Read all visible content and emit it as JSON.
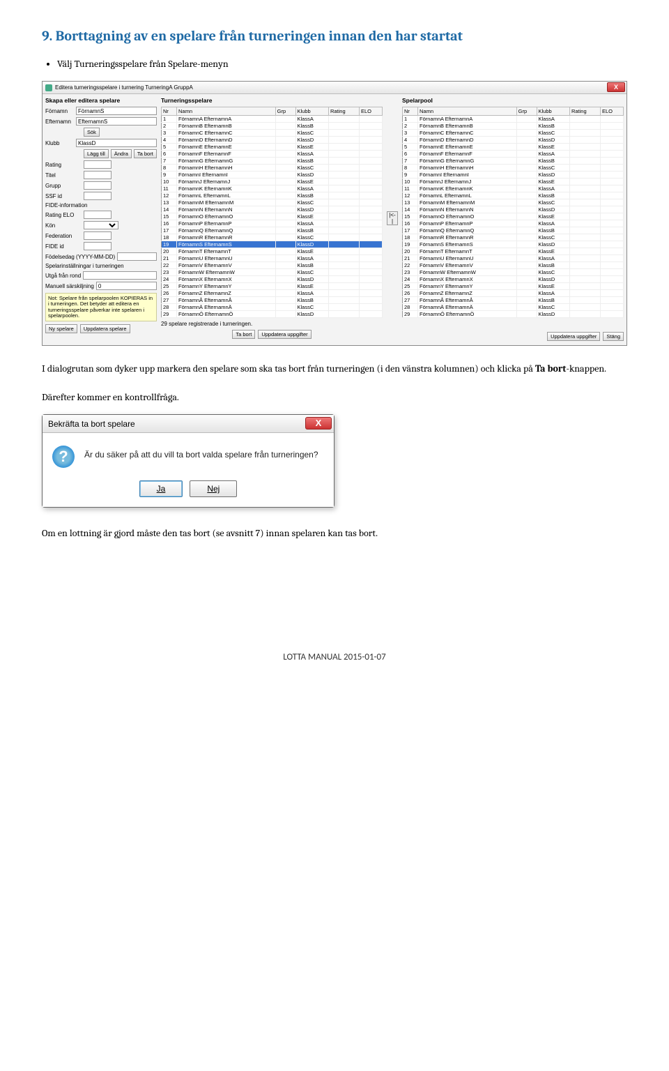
{
  "section": {
    "title": "9. Borttagning av en spelare från turneringen innan den har startat",
    "bullet": "Välj Turneringsspelare från Spelare-menyn"
  },
  "win": {
    "title": "Editera turneringsspelare i turnering TurneringA GruppA",
    "close": "X",
    "left": {
      "heading": "Skapa eller editera spelare",
      "fornamn_label": "Förnamn",
      "fornamn_value": "FörnamnS",
      "efternamn_label": "Efternamn",
      "efternamn_value": "EfternamnS",
      "sok": "Sök",
      "klubb_label": "Klubb",
      "klubb_value": "KlassD",
      "laggtill": "Lägg till",
      "andra": "Ändra",
      "tabort": "Ta bort",
      "rating_label": "Rating",
      "titel_label": "Titel",
      "grupp_label": "Grupp",
      "ssfid_label": "SSF id",
      "fide_label": "FIDE-information",
      "ratingelo_label": "Rating ELO",
      "kon_label": "Kön",
      "federation_label": "Federation",
      "fideid_label": "FIDE id",
      "fodelsedag_label": "Födelsedag (YYYY-MM-DD)",
      "spelarinst_label": "Spelarinställningar i turneringen",
      "utga_label": "Utgå från rond",
      "manuell_label": "Manuell särskiljning",
      "manuell_value": "0",
      "note": "Not: Spelare från spelarpoolen KOPIERAS in i turneringen.\nDet betyder att editera en turneringsspelare påverkar inte spelaren i spelarpoolen.",
      "nyspelare": "Ny spelare",
      "uppdatera": "Uppdatera spelare"
    },
    "mid": {
      "heading": "Turneringsspelare",
      "cols": {
        "nr": "Nr",
        "namn": "Namn",
        "grp": "Grp",
        "klubb": "Klubb",
        "rating": "Rating",
        "elo": "ELO"
      },
      "status": "29 spelare registrerade i turneringen.",
      "tabort": "Ta bort",
      "uppdatera": "Uppdatera uppgifter"
    },
    "right": {
      "heading": "Spelarpool",
      "cols": {
        "nr": "Nr",
        "namn": "Namn",
        "grp": "Grp",
        "klubb": "Klubb",
        "rating": "Rating",
        "elo": "ELO"
      },
      "uppdatera": "Uppdatera uppgifter",
      "stang": "Stäng"
    },
    "arrow": "|<-|",
    "rows": [
      {
        "nr": "1",
        "namn": "FörnamnA EfternamnA",
        "klubb": "KlassA"
      },
      {
        "nr": "2",
        "namn": "FörnamnB EfternamnB",
        "klubb": "KlassB"
      },
      {
        "nr": "3",
        "namn": "FörnamnC EfternamnC",
        "klubb": "KlassC"
      },
      {
        "nr": "4",
        "namn": "FörnamnD EfternamnD",
        "klubb": "KlassD"
      },
      {
        "nr": "5",
        "namn": "FörnamnE EfternamnE",
        "klubb": "KlassE"
      },
      {
        "nr": "6",
        "namn": "FörnamnF EfternamnF",
        "klubb": "KlassA"
      },
      {
        "nr": "7",
        "namn": "FörnamnG EfternamnG",
        "klubb": "KlassB"
      },
      {
        "nr": "8",
        "namn": "FörnamnH EfternamnH",
        "klubb": "KlassC"
      },
      {
        "nr": "9",
        "namn": "FörnamnI EfternamnI",
        "klubb": "KlassD"
      },
      {
        "nr": "10",
        "namn": "FörnamnJ EfternamnJ",
        "klubb": "KlassE"
      },
      {
        "nr": "11",
        "namn": "FörnamnK EfternamnK",
        "klubb": "KlassA"
      },
      {
        "nr": "12",
        "namn": "FörnamnL EfternamnL",
        "klubb": "KlassB"
      },
      {
        "nr": "13",
        "namn": "FörnamnM EfternamnM",
        "klubb": "KlassC"
      },
      {
        "nr": "14",
        "namn": "FörnamnN EfternamnN",
        "klubb": "KlassD"
      },
      {
        "nr": "15",
        "namn": "FörnamnO EfternamnO",
        "klubb": "KlassE"
      },
      {
        "nr": "16",
        "namn": "FörnamnP EfternamnP",
        "klubb": "KlassA"
      },
      {
        "nr": "17",
        "namn": "FörnamnQ EfternamnQ",
        "klubb": "KlassB"
      },
      {
        "nr": "18",
        "namn": "FörnamnR EfternamnR",
        "klubb": "KlassC"
      },
      {
        "nr": "19",
        "namn": "FörnamnS EfternamnS",
        "klubb": "KlassD",
        "sel": true
      },
      {
        "nr": "20",
        "namn": "FörnamnT EfternamnT",
        "klubb": "KlassE"
      },
      {
        "nr": "21",
        "namn": "FörnamnU EfternamnU",
        "klubb": "KlassA"
      },
      {
        "nr": "22",
        "namn": "FörnamnV EfternamnV",
        "klubb": "KlassB"
      },
      {
        "nr": "23",
        "namn": "FörnamnW EfternamnW",
        "klubb": "KlassC"
      },
      {
        "nr": "24",
        "namn": "FörnamnX EfternamnX",
        "klubb": "KlassD"
      },
      {
        "nr": "25",
        "namn": "FörnamnY EfternamnY",
        "klubb": "KlassE"
      },
      {
        "nr": "26",
        "namn": "FörnamnZ EfternamnZ",
        "klubb": "KlassA"
      },
      {
        "nr": "27",
        "namn": "FörnamnÅ EfternamnÅ",
        "klubb": "KlassB"
      },
      {
        "nr": "28",
        "namn": "FörnamnÄ EfternamnÄ",
        "klubb": "KlassC"
      },
      {
        "nr": "29",
        "namn": "FörnamnÖ EfternamnÖ",
        "klubb": "KlassD"
      }
    ]
  },
  "para1a": "I dialogrutan som dyker upp markera den spelare som ska tas bort från turneringen (i den vänstra kolumnen) och klicka på ",
  "para1b": "Ta bort",
  "para1c": "-knappen.",
  "para2": "Därefter kommer en kontrollfråga.",
  "dlg2": {
    "title": "Bekräfta ta bort spelare",
    "close": "X",
    "msg": "Är du säker på att du vill ta bort valda spelare från turneringen?",
    "ja": "Ja",
    "nej": "Nej"
  },
  "para3": "Om en lottning är gjord måste den tas bort (se avsnitt 7) innan spelaren kan tas bort.",
  "footer": "LOTTA MANUAL 2015-01-07"
}
